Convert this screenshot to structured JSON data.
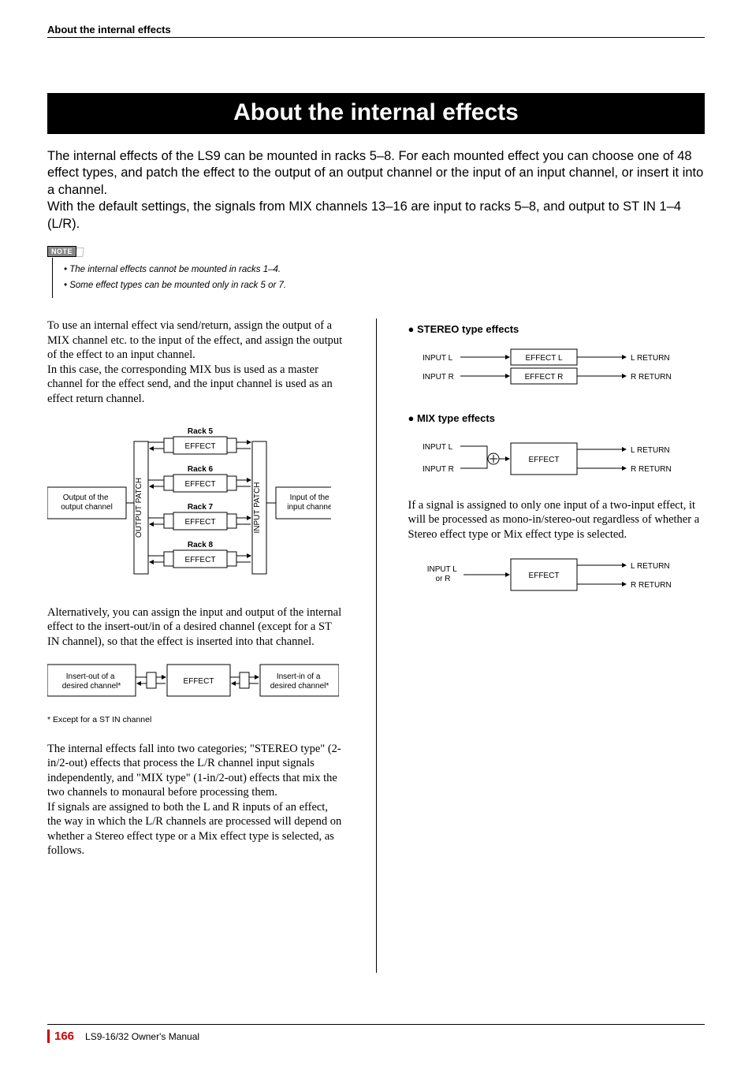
{
  "header": {
    "running_title": "About the internal effects"
  },
  "title": "About the internal effects",
  "intro": "The internal effects of the LS9 can be mounted in racks 5–8. For each mounted effect you can choose one of 48 effect types, and patch the effect to the output of an output channel or the input of an input channel, or insert it into a channel.\nWith the default settings, the signals from MIX channels 13–16 are input to racks 5–8, and output to ST IN 1–4 (L/R).",
  "note": {
    "label": "NOTE",
    "items": [
      "• The internal effects cannot be mounted in racks 1–4.",
      "• Some effect types can be mounted only in rack 5 or 7."
    ]
  },
  "left": {
    "p1": "To use an internal effect via send/return, assign the output of a MIX channel etc. to the input of the effect, and assign the output of the effect to an input channel.",
    "p2": "In this case, the corresponding MIX bus is used as a master channel for the effect send, and the input channel is used as an effect return channel.",
    "diagram1": {
      "left_box": "Output of the\noutput channel",
      "right_box": "Input of the\ninput channel",
      "output_patch": "OUTPUT PATCH",
      "input_patch": "INPUT PATCH",
      "racks": [
        "Rack 5",
        "Rack 6",
        "Rack 7",
        "Rack 8"
      ],
      "effect_box": "EFFECT"
    },
    "p3": "Alternatively, you can assign the input and output of the internal effect to the insert-out/in of a desired channel (except for a ST IN channel), so that the effect is inserted into that channel.",
    "diagram2": {
      "left_box": "Insert-out of a\ndesired channel*",
      "center_box": "EFFECT",
      "right_box": "Insert-in of a\ndesired channel*"
    },
    "footnote": "* Except for a ST IN channel",
    "p4": "The internal effects fall into two categories; \"STEREO type\" (2-in/2-out) effects that process the L/R channel input signals independently, and \"MIX type\" (1-in/2-out) effects that mix the two channels to monaural before processing them.",
    "p5": "If signals are assigned to both the L and R inputs of an effect, the way in which the L/R channels are processed will depend on whether a Stereo effect type or a Mix effect type is selected, as follows."
  },
  "right": {
    "stereo_heading": "● STEREO type effects",
    "stereo_diagram": {
      "input_l": "INPUT L",
      "input_r": "INPUT R",
      "effect_l": "EFFECT L",
      "effect_r": "EFFECT R",
      "return_l": "L RETURN",
      "return_r": "R RETURN"
    },
    "mix_heading": "● MIX type effects",
    "mix_diagram": {
      "input_l": "INPUT L",
      "input_r": "INPUT R",
      "effect": "EFFECT",
      "return_l": "L RETURN",
      "return_r": "R RETURN"
    },
    "p1": "If a signal is assigned to only one input of a two-input effect, it will be processed as mono-in/stereo-out regardless of whether a Stereo effect type or Mix effect type is selected.",
    "mono_diagram": {
      "input": "INPUT L\nor R",
      "effect": "EFFECT",
      "return_l": "L RETURN",
      "return_r": "R RETURN"
    }
  },
  "footer": {
    "page_number": "166",
    "manual": "LS9-16/32  Owner's Manual"
  }
}
